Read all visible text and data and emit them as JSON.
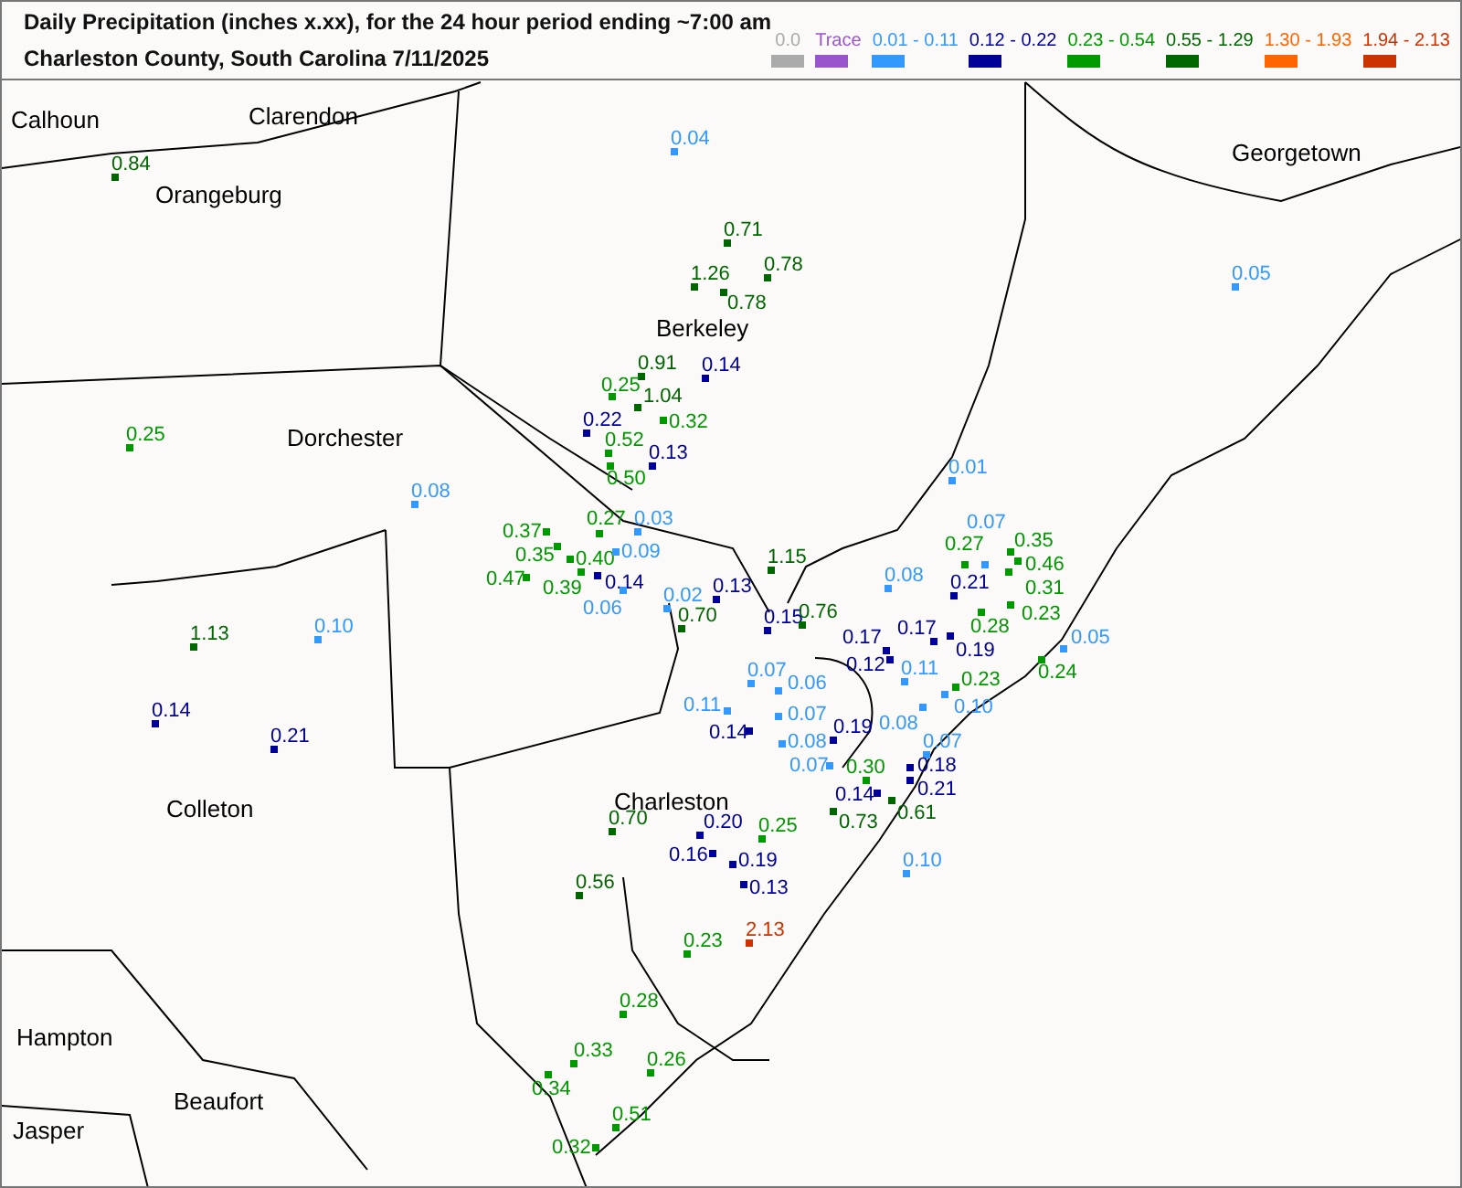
{
  "header": {
    "title": "Daily Precipitation (inches  x.xx),  for the 24 hour period ending ~7:00 am",
    "subtitle": "Charleston County, South Carolina  7/11/2025"
  },
  "legend": [
    {
      "label": "0.0",
      "color": "#aaaaaa"
    },
    {
      "label": "Trace",
      "color": "#9955cc"
    },
    {
      "label": "0.01 - 0.11",
      "color": "#3399ff"
    },
    {
      "label": "0.12 - 0.22",
      "color": "#000099"
    },
    {
      "label": "0.23 - 0.54",
      "color": "#009900"
    },
    {
      "label": "0.55 - 1.29",
      "color": "#006600"
    },
    {
      "label": "1.30 - 1.93",
      "color": "#ff6600"
    },
    {
      "label": "1.94 - 2.13",
      "color": "#cc3300"
    }
  ],
  "places": [
    "Calhoun",
    "Clarendon",
    "Orangeburg",
    "Georgetown",
    "Berkeley",
    "Dorchester",
    "Colleton",
    "Charleston",
    "Hampton",
    "Beaufort",
    "Jasper"
  ],
  "stations": [
    {
      "value": "0.04",
      "color": "#3399ff"
    },
    {
      "value": "0.84",
      "color": "#006600"
    },
    {
      "value": "0.71",
      "color": "#006600"
    },
    {
      "value": "1.26",
      "color": "#006600"
    },
    {
      "value": "0.78",
      "color": "#006600"
    },
    {
      "value": "0.78",
      "color": "#006600"
    },
    {
      "value": "0.05",
      "color": "#3399ff"
    },
    {
      "value": "0.91",
      "color": "#006600"
    },
    {
      "value": "0.14",
      "color": "#000099"
    },
    {
      "value": "0.25",
      "color": "#009900"
    },
    {
      "value": "1.04",
      "color": "#006600"
    },
    {
      "value": "0.32",
      "color": "#009900"
    },
    {
      "value": "0.22",
      "color": "#000099"
    },
    {
      "value": "0.25",
      "color": "#009900"
    },
    {
      "value": "0.52",
      "color": "#009900"
    },
    {
      "value": "0.50",
      "color": "#009900"
    },
    {
      "value": "0.13",
      "color": "#000099"
    },
    {
      "value": "0.01",
      "color": "#3399ff"
    },
    {
      "value": "0.08",
      "color": "#3399ff"
    },
    {
      "value": "0.37",
      "color": "#009900"
    },
    {
      "value": "0.35",
      "color": "#009900"
    },
    {
      "value": "0.27",
      "color": "#009900"
    },
    {
      "value": "0.03",
      "color": "#3399ff"
    },
    {
      "value": "0.40",
      "color": "#009900"
    },
    {
      "value": "0.09",
      "color": "#3399ff"
    },
    {
      "value": "0.47",
      "color": "#009900"
    },
    {
      "value": "0.39",
      "color": "#009900"
    },
    {
      "value": "0.14",
      "color": "#000099"
    },
    {
      "value": "0.06",
      "color": "#3399ff"
    },
    {
      "value": "0.02",
      "color": "#3399ff"
    },
    {
      "value": "0.13",
      "color": "#000099"
    },
    {
      "value": "0.70",
      "color": "#006600"
    },
    {
      "value": "1.15",
      "color": "#006600"
    },
    {
      "value": "0.15",
      "color": "#000099"
    },
    {
      "value": "0.76",
      "color": "#006600"
    },
    {
      "value": "0.08",
      "color": "#3399ff"
    },
    {
      "value": "0.27",
      "color": "#009900"
    },
    {
      "value": "0.07",
      "color": "#3399ff"
    },
    {
      "value": "0.35",
      "color": "#009900"
    },
    {
      "value": "0.46",
      "color": "#009900"
    },
    {
      "value": "0.21",
      "color": "#000099"
    },
    {
      "value": "0.31",
      "color": "#009900"
    },
    {
      "value": "0.23",
      "color": "#009900"
    },
    {
      "value": "0.28",
      "color": "#009900"
    },
    {
      "value": "0.17",
      "color": "#000099"
    },
    {
      "value": "0.12",
      "color": "#000099"
    },
    {
      "value": "0.17",
      "color": "#000099"
    },
    {
      "value": "0.19",
      "color": "#000099"
    },
    {
      "value": "0.05",
      "color": "#3399ff"
    },
    {
      "value": "0.11",
      "color": "#3399ff"
    },
    {
      "value": "0.23",
      "color": "#009900"
    },
    {
      "value": "0.24",
      "color": "#009900"
    },
    {
      "value": "0.10",
      "color": "#3399ff"
    },
    {
      "value": "0.08",
      "color": "#3399ff"
    },
    {
      "value": "1.13",
      "color": "#006600"
    },
    {
      "value": "0.10",
      "color": "#3399ff"
    },
    {
      "value": "0.14",
      "color": "#000099"
    },
    {
      "value": "0.21",
      "color": "#000099"
    },
    {
      "value": "0.07",
      "color": "#3399ff"
    },
    {
      "value": "0.06",
      "color": "#3399ff"
    },
    {
      "value": "0.11",
      "color": "#3399ff"
    },
    {
      "value": "0.07",
      "color": "#3399ff"
    },
    {
      "value": "0.14",
      "color": "#000099"
    },
    {
      "value": "0.08",
      "color": "#3399ff"
    },
    {
      "value": "0.19",
      "color": "#000099"
    },
    {
      "value": "0.07",
      "color": "#3399ff"
    },
    {
      "value": "0.07",
      "color": "#3399ff"
    },
    {
      "value": "0.30",
      "color": "#009900"
    },
    {
      "value": "0.18",
      "color": "#000099"
    },
    {
      "value": "0.14",
      "color": "#000099"
    },
    {
      "value": "0.21",
      "color": "#000099"
    },
    {
      "value": "0.70",
      "color": "#006600"
    },
    {
      "value": "0.20",
      "color": "#000099"
    },
    {
      "value": "0.25",
      "color": "#009900"
    },
    {
      "value": "0.73",
      "color": "#006600"
    },
    {
      "value": "0.61",
      "color": "#006600"
    },
    {
      "value": "0.16",
      "color": "#000099"
    },
    {
      "value": "0.19",
      "color": "#000099"
    },
    {
      "value": "0.13",
      "color": "#000099"
    },
    {
      "value": "0.10",
      "color": "#3399ff"
    },
    {
      "value": "0.56",
      "color": "#006600"
    },
    {
      "value": "0.23",
      "color": "#009900"
    },
    {
      "value": "2.13",
      "color": "#cc3300"
    },
    {
      "value": "0.28",
      "color": "#009900"
    },
    {
      "value": "0.33",
      "color": "#009900"
    },
    {
      "value": "0.34",
      "color": "#009900"
    },
    {
      "value": "0.26",
      "color": "#009900"
    },
    {
      "value": "0.51",
      "color": "#009900"
    },
    {
      "value": "0.32",
      "color": "#009900"
    }
  ]
}
